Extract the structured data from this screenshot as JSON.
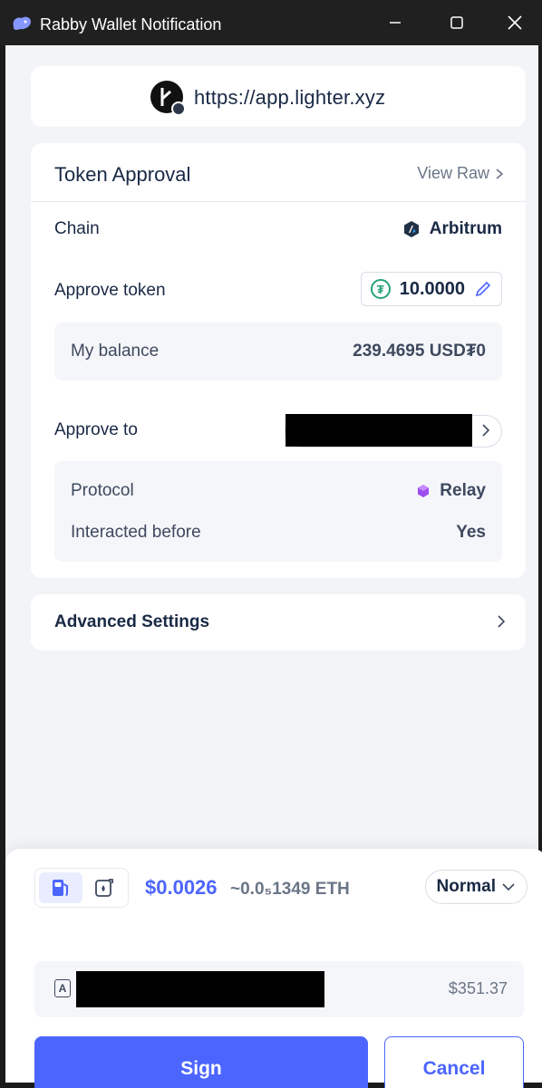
{
  "window": {
    "title": "Rabby Wallet Notification"
  },
  "site": {
    "url": "https://app.lighter.xyz"
  },
  "approval": {
    "title": "Token Approval",
    "view_raw": "View Raw",
    "chain_label": "Chain",
    "chain_value": "Arbitrum",
    "approve_token_label": "Approve token",
    "approve_token_amount": "10.0000",
    "balance_label": "My balance",
    "balance_value": "239.4695 USD₮0",
    "approve_to_label": "Approve to",
    "protocol_label": "Protocol",
    "protocol_value": "Relay",
    "interacted_label": "Interacted before",
    "interacted_value": "Yes"
  },
  "advanced": {
    "label": "Advanced Settings"
  },
  "footer": {
    "gas_usd": "$0.0026",
    "gas_eth": "~0.0₅1349 ETH",
    "speed": "Normal",
    "account_balance": "$351.37",
    "account_icon_letter": "A",
    "sign_label": "Sign",
    "cancel_label": "Cancel"
  },
  "colors": {
    "accent": "#4c65ff",
    "text": "#192945",
    "muted": "#6a7587",
    "background": "#f2f4f7",
    "usdt": "#26a17b"
  },
  "icons": {
    "app": "rabby-icon",
    "usdt": "usdt-icon",
    "arbitrum": "arbitrum-icon",
    "relay": "relay-icon",
    "gas": "gas-pump-icon",
    "gas_alt": "gas-account-icon",
    "edit": "pencil-icon"
  }
}
